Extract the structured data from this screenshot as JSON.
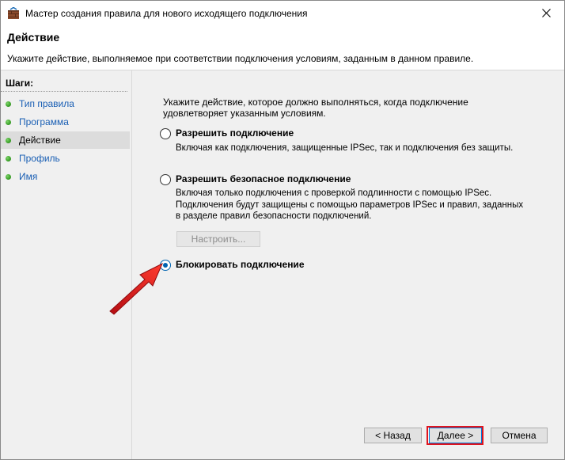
{
  "window": {
    "title": "Мастер создания правила для нового исходящего подключения"
  },
  "header": {
    "title": "Действие",
    "description": "Укажите действие, выполняемое при соответствии подключения условиям, заданным в данном правиле."
  },
  "sidebar": {
    "heading": "Шаги:",
    "steps": [
      {
        "label": "Тип правила"
      },
      {
        "label": "Программа"
      },
      {
        "label": "Действие"
      },
      {
        "label": "Профиль"
      },
      {
        "label": "Имя"
      }
    ]
  },
  "content": {
    "instruction": "Укажите действие, которое должно выполняться, когда подключение удовлетворяет указанным условиям.",
    "options": [
      {
        "label": "Разрешить подключение",
        "description": "Включая как подключения, защищенные IPSec, так и подключения без защиты."
      },
      {
        "label": "Разрешить безопасное подключение",
        "description": "Включая только подключения с проверкой подлинности с помощью IPSec. Подключения будут защищены с помощью параметров IPSec и правил, заданных в разделе правил безопасности подключений."
      },
      {
        "label": "Блокировать подключение",
        "description": ""
      }
    ],
    "configure_label": "Настроить..."
  },
  "footer": {
    "back_label": "< Назад",
    "next_label": "Далее >",
    "cancel_label": "Отмена"
  },
  "colors": {
    "accent": "#0063b1",
    "highlight": "#e0141e",
    "link": "#1a5fb4"
  }
}
